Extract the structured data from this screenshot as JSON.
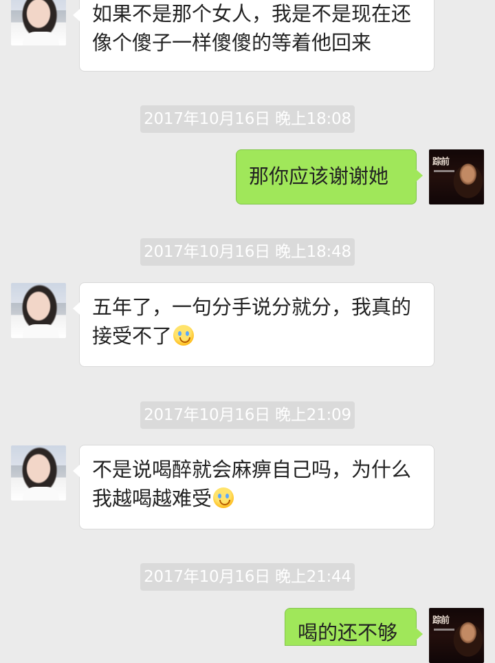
{
  "chat": {
    "messages": [
      {
        "sender": "incoming",
        "avatar_icon": "female-avatar-icon",
        "text": "如果不是那个女人，我是不是现在还像个傻子一样傻傻的等着他回来"
      },
      {
        "timestamp": "2017年10月16日 晚上18:08"
      },
      {
        "sender": "outgoing",
        "avatar_icon": "male-avatar-icon",
        "avatar_text": "踪前",
        "text": "那你应该谢谢她"
      },
      {
        "timestamp": "2017年10月16日 晚上18:48"
      },
      {
        "sender": "incoming",
        "avatar_icon": "female-avatar-icon",
        "text": "五年了，一句分手说分就分，我真的接受不了",
        "emoji_icon": "crying-face-icon"
      },
      {
        "timestamp": "2017年10月16日 晚上21:09"
      },
      {
        "sender": "incoming",
        "avatar_icon": "female-avatar-icon",
        "text": "不是说喝醉就会麻痹自己吗，为什么我越喝越难受",
        "emoji_icon": "crying-face-icon"
      },
      {
        "timestamp": "2017年10月16日 晚上21:44"
      },
      {
        "sender": "outgoing",
        "avatar_icon": "male-avatar-icon",
        "avatar_text": "踪前",
        "text": "喝的还不够"
      }
    ]
  },
  "colors": {
    "background": "#ebebeb",
    "incoming_bubble": "#ffffff",
    "outgoing_bubble": "#a0e75a",
    "timestamp_bg": "#dadada",
    "timestamp_text": "#ffffff"
  }
}
